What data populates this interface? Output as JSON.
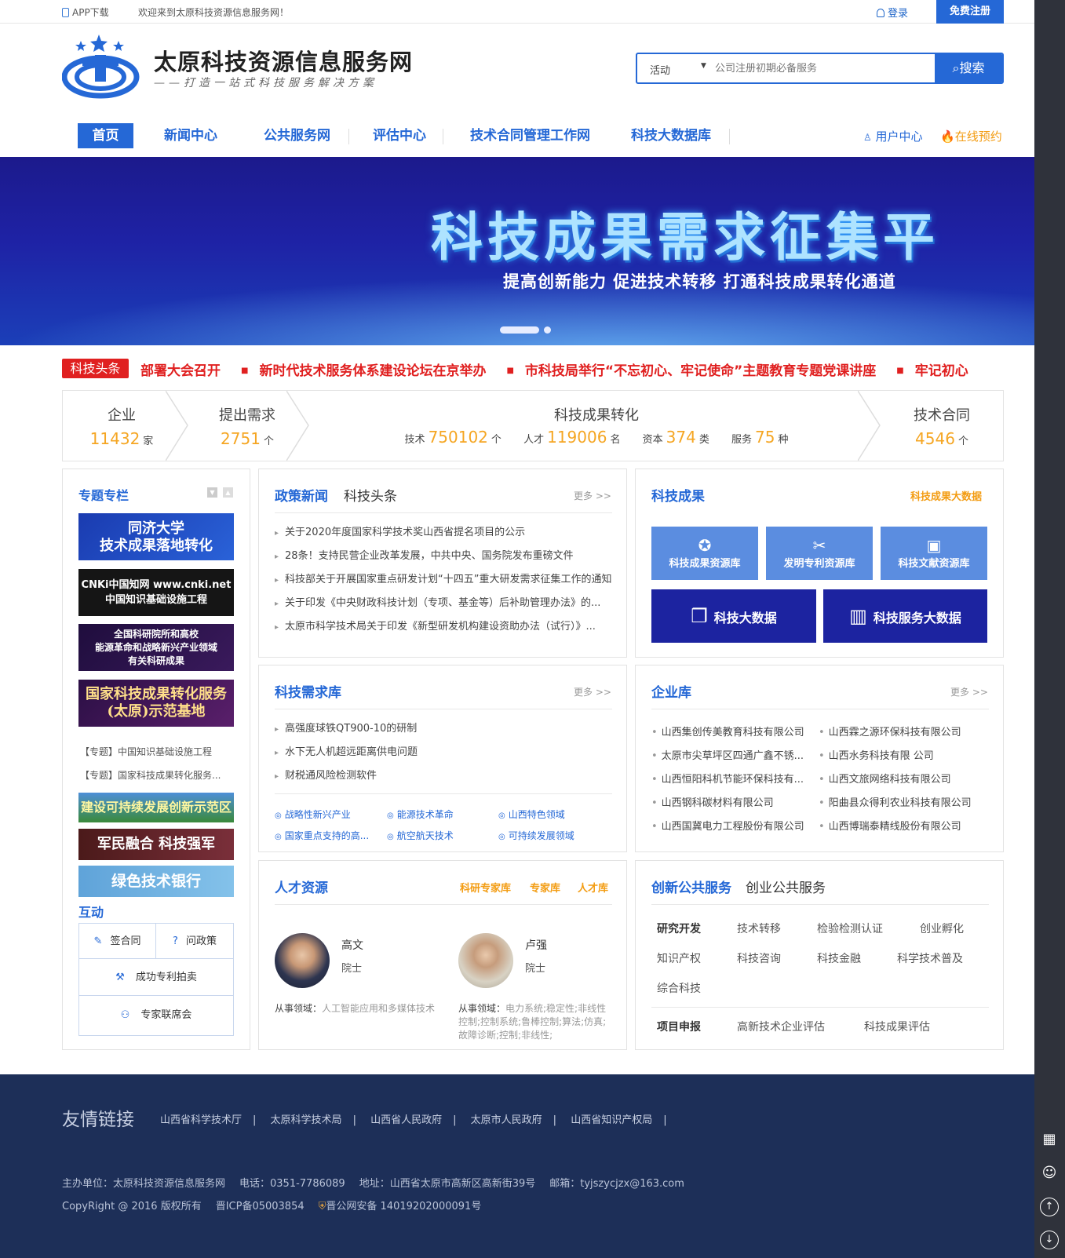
{
  "topbar": {
    "app": "APP下载",
    "welcome": "欢迎来到太原科技资源信息服务网！",
    "login": "登录",
    "register": "免费注册"
  },
  "header": {
    "site_name": "太原科技资源信息服务网",
    "slogan": "——打造一站式科技服务解决方案"
  },
  "search": {
    "category": "活动",
    "placeholder": "公司注册初期必备服务",
    "button": "搜索"
  },
  "nav": {
    "items": [
      "首页",
      "新闻中心",
      "公共服务网",
      "评估中心",
      "技术合同管理工作网",
      "科技大数据库"
    ],
    "user_center": "用户中心",
    "booking": "在线预约"
  },
  "banner": {
    "title": "科技成果需求征集平",
    "subtitle": "提高创新能力  促进技术转移  打通科技成果转化通道"
  },
  "ticker": {
    "tag": "科技头条",
    "items": [
      "部署大会召开",
      "新时代技术服务体系建设论坛在京举办",
      "市科技局举行“不忘初心、牢记使命”主题教育专题党课讲座",
      "牢记初心"
    ]
  },
  "stats": {
    "company": {
      "label": "企业",
      "value": "11432",
      "unit": "家"
    },
    "demand": {
      "label": "提出需求",
      "value": "2751",
      "unit": "个"
    },
    "conversion": {
      "label": "科技成果转化",
      "items": [
        {
          "label": "技术",
          "value": "750102",
          "unit": "个"
        },
        {
          "label": "人才",
          "value": "119006",
          "unit": "名"
        },
        {
          "label": "资本",
          "value": "374",
          "unit": "类"
        },
        {
          "label": "服务",
          "value": "75",
          "unit": "种"
        }
      ]
    },
    "contract": {
      "label": "技术合同",
      "value": "4546",
      "unit": "个"
    }
  },
  "special": {
    "title": "专题专栏",
    "promos": [
      "同济大学\n技术成果落地转化",
      "CNKi中国知网 www.cnki.net\n中国知识基础设施工程",
      "全国科研院所和高校\n能源革命和战略新兴产业领域\n有关科研成果",
      "国家科技成果转化服务\n(太原)示范基地"
    ],
    "links": [
      "【专题】中国知识基础设施工程",
      "【专题】国家科技成果转化服务..."
    ],
    "banners": [
      "建设可持续发展创新示范区",
      "军民融合 科技强军",
      "绿色技术银行"
    ]
  },
  "interact": {
    "title": "互动",
    "items": [
      "签合同",
      "问政策",
      "成功专利拍卖",
      "专家联席会"
    ]
  },
  "news": {
    "tabs": [
      "政策新闻",
      "科技头条"
    ],
    "more": "更多 >>",
    "items": [
      "关于2020年度国家科学技术奖山西省提名项目的公示",
      "28条！支持民营企业改革发展，中共中央、国务院发布重磅文件",
      "科技部关于开展国家重点研发计划“十四五”重大研发需求征集工作的通知",
      "关于印发《中央财政科技计划（专项、基金等）后补助管理办法》的...",
      "太原市科学技术局关于印发《新型研发机构建设资助办法（试行）》..."
    ]
  },
  "achievements": {
    "title": "科技成果",
    "link": "科技成果大数据",
    "tiles": [
      "科技成果资源库",
      "发明专利资源库",
      "科技文献资源库"
    ],
    "big": [
      "科技大数据",
      "科技服务大数据"
    ]
  },
  "demand_lib": {
    "title": "科技需求库",
    "more": "更多 >>",
    "items": [
      "高强度球铁QT900-10的研制",
      "水下无人机超远距离供电问题",
      "财税通风险检测软件"
    ],
    "tags": [
      "战略性新兴产业",
      "能源技术革命",
      "山西特色领域",
      "国家重点支持的高...",
      "航空航天技术",
      "可持续发展领域"
    ]
  },
  "enterprise": {
    "title": "企业库",
    "more": "更多 >>",
    "items": [
      "山西集创传美教育科技有限公司",
      "山西霖之源环保科技有限公司",
      "太原市尖草坪区四通广鑫不锈...",
      "山西水务科技有限 公司",
      "山西恒阳科机节能环保科技有...",
      "山西文旅网络科技有限公司",
      "山西钢科碳材料有限公司",
      "阳曲县众得利农业科技有限公司",
      "山西国冀电力工程股份有限公司",
      "山西博瑞泰精线股份有限公司"
    ]
  },
  "talent": {
    "title": "人才资源",
    "links": [
      "科研专家库",
      "专家库",
      "人才库"
    ],
    "field_label": "从事领域：",
    "people": [
      {
        "name": "高文",
        "title": "院士",
        "field": "人工智能应用和多媒体技术"
      },
      {
        "name": "卢强",
        "title": "院士",
        "field": "电力系统;稳定性;非线性控制;控制系统;鲁棒控制;算法;仿真;故障诊断;控制;非线性;"
      }
    ]
  },
  "services": {
    "tabs": [
      "创新公共服务",
      "创业公共服务"
    ],
    "row1_head": "研究开发",
    "row1": [
      "技术转移",
      "检验检测认证",
      "创业孵化",
      "知识产权",
      "科技咨询",
      "科技金融",
      "科学技术普及",
      "综合科技"
    ],
    "row2_head": "项目申报",
    "row2": [
      "高新技术企业评估",
      "科技成果评估"
    ]
  },
  "footer": {
    "links_title": "友情链接",
    "links": [
      "山西省科学技术厅",
      "太原科学技术局",
      "山西省人民政府",
      "太原市人民政府",
      "山西省知识产权局"
    ],
    "host": "主办单位：太原科技资源信息服务网",
    "phone": "电话：0351-7786089",
    "address": "地址：山西省太原市高新区高新街39号",
    "email": "邮箱：tyjszycjzx@163.com",
    "copyright": "CopyRight @ 2016 版权所有",
    "icp": "晋ICP备05003854",
    "police": "晋公网安备 14019202000091号"
  },
  "colors": {
    "primary": "#2568d6",
    "accent": "#f5a623",
    "alert": "#e02020",
    "footer": "#1d2f58"
  }
}
